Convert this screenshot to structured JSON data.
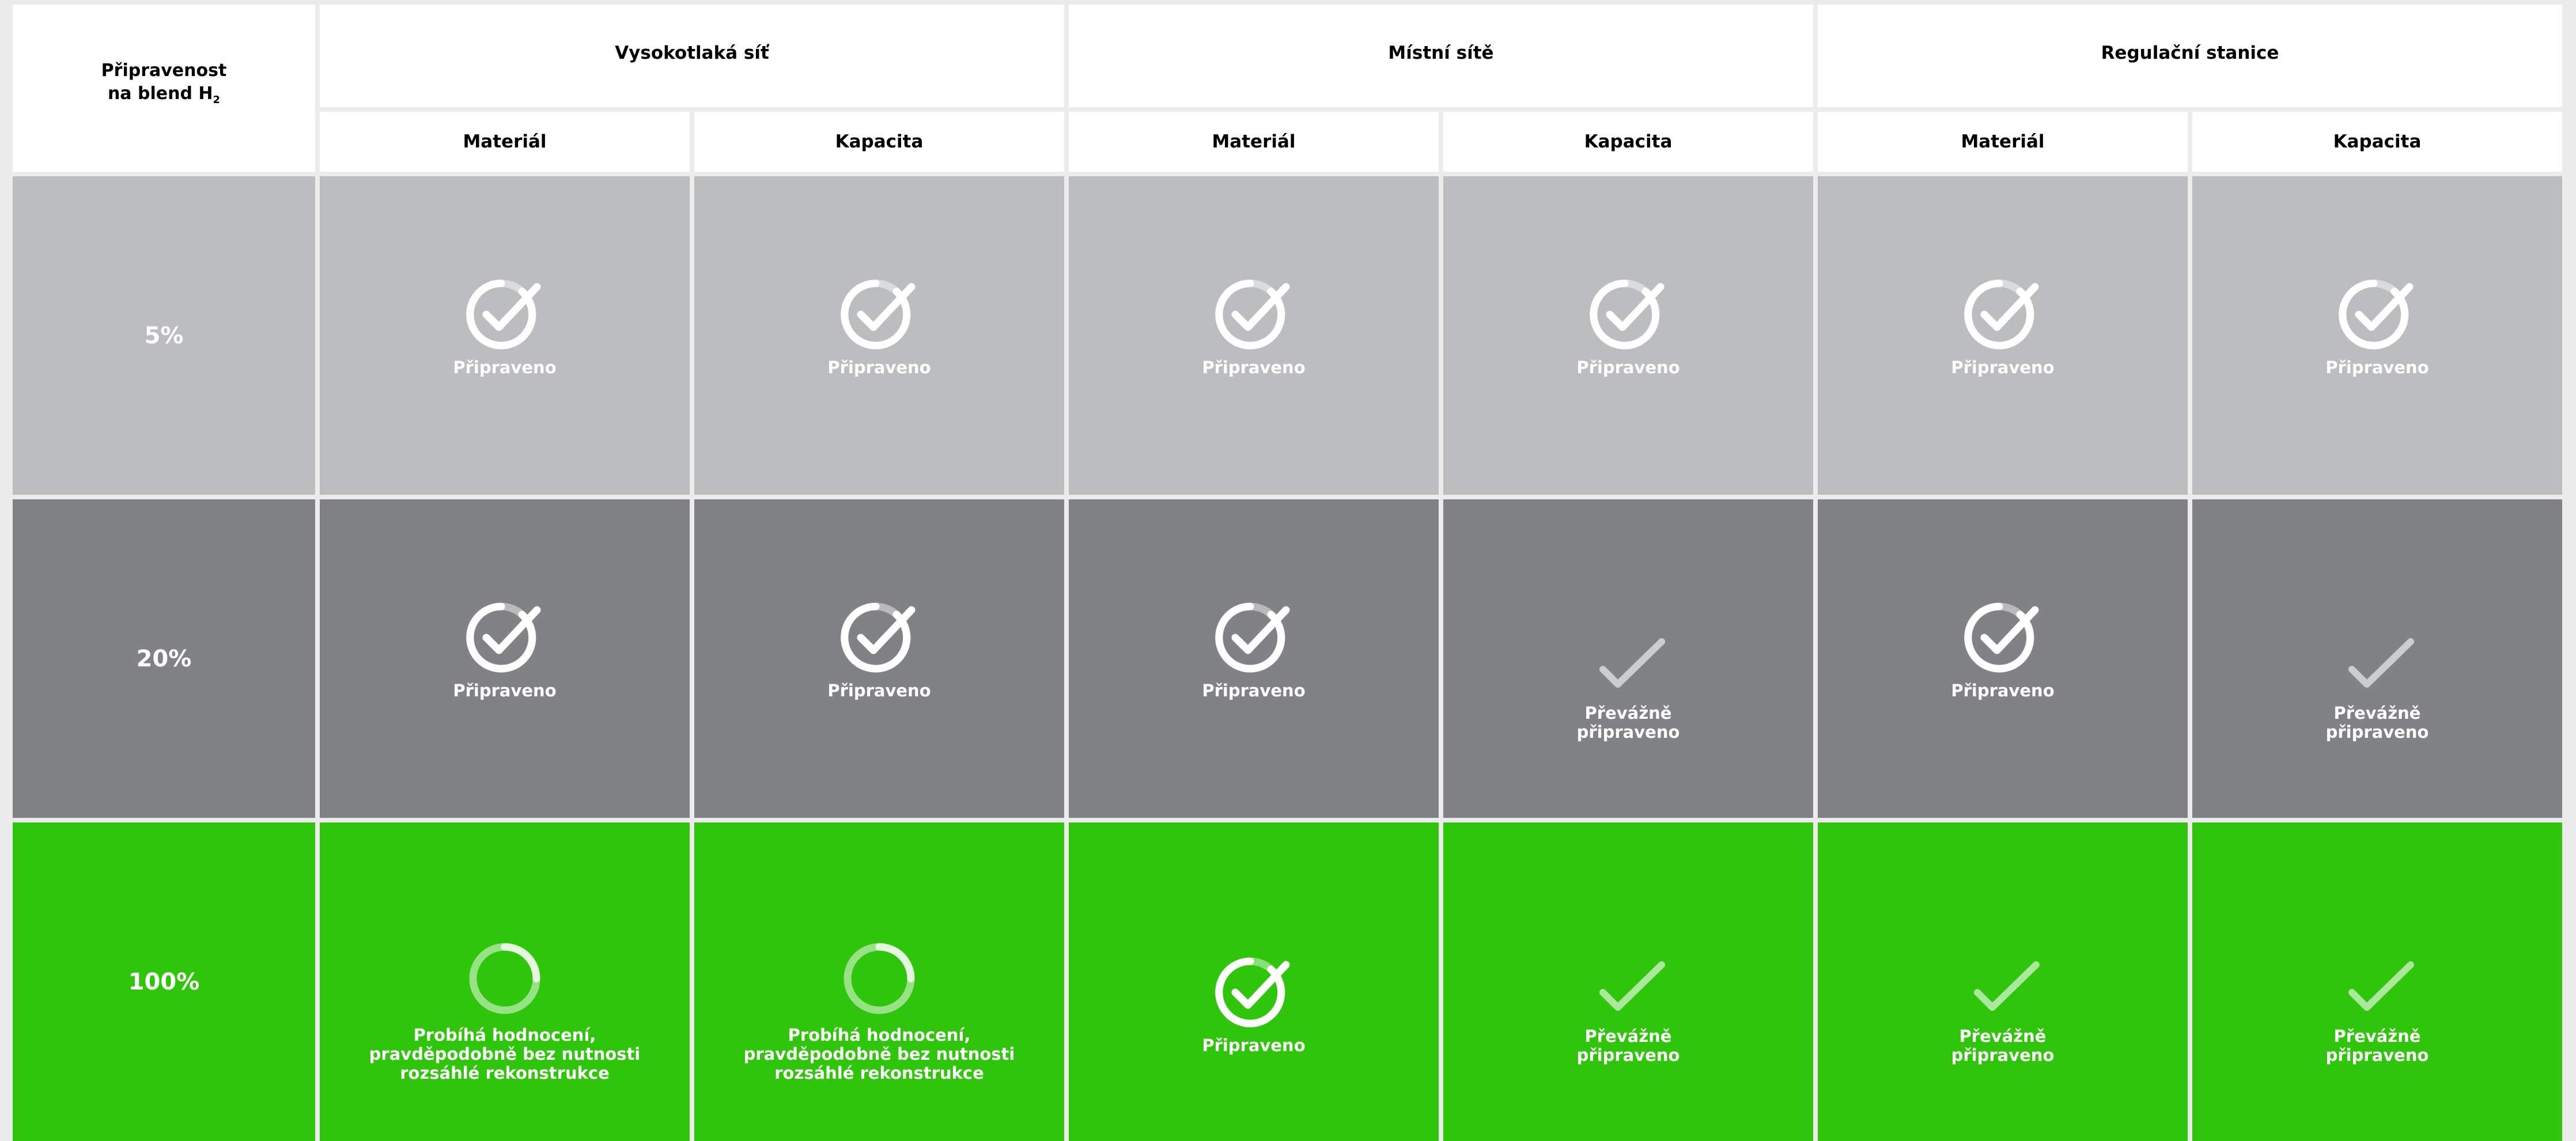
{
  "colors": {
    "row_5": "#bcbdbf",
    "row_20": "#818285",
    "row_100": "#2ec50a",
    "header_bg": "#ffffff",
    "page_bg": "#ececec"
  },
  "corner_header": {
    "line1": "Připravenost",
    "line2": "na blend H",
    "subscript": "2"
  },
  "groups": [
    "Vysokotlaká síť",
    "Místní sítě",
    "Regulační stanice"
  ],
  "subheaders": [
    "Materiál",
    "Kapacita",
    "Materiál",
    "Kapacita",
    "Materiál",
    "Kapacita"
  ],
  "rows": [
    {
      "label": "5%",
      "cells": [
        {
          "status": "ready",
          "icon": "circle-check-icon",
          "text": "Připraveno"
        },
        {
          "status": "ready",
          "icon": "circle-check-icon",
          "text": "Připraveno"
        },
        {
          "status": "ready",
          "icon": "circle-check-icon",
          "text": "Připraveno"
        },
        {
          "status": "ready",
          "icon": "circle-check-icon",
          "text": "Připraveno"
        },
        {
          "status": "ready",
          "icon": "circle-check-icon",
          "text": "Připraveno"
        },
        {
          "status": "ready",
          "icon": "circle-check-icon",
          "text": "Připraveno"
        }
      ]
    },
    {
      "label": "20%",
      "cells": [
        {
          "status": "ready",
          "icon": "circle-check-icon",
          "text": "Připraveno"
        },
        {
          "status": "ready",
          "icon": "circle-check-icon",
          "text": "Připraveno"
        },
        {
          "status": "ready",
          "icon": "circle-check-icon",
          "text": "Připraveno"
        },
        {
          "status": "mostly",
          "icon": "check-icon",
          "text": "Převážně\npřipraveno"
        },
        {
          "status": "ready",
          "icon": "circle-check-icon",
          "text": "Připraveno"
        },
        {
          "status": "mostly",
          "icon": "check-icon",
          "text": "Převážně\npřipraveno"
        }
      ]
    },
    {
      "label": "100%",
      "cells": [
        {
          "status": "eval",
          "icon": "progress-ring-icon",
          "text": "Probíhá hodnocení,\npravděpodobně bez nutnosti\nrozsáhlé rekonstrukce"
        },
        {
          "status": "eval",
          "icon": "progress-ring-icon",
          "text": "Probíhá hodnocení,\npravděpodobně bez nutnosti\nrozsáhlé rekonstrukce"
        },
        {
          "status": "ready",
          "icon": "circle-check-icon",
          "text": "Připraveno"
        },
        {
          "status": "mostly",
          "icon": "check-icon",
          "text": "Převážně\npřipraveno"
        },
        {
          "status": "mostly",
          "icon": "check-icon",
          "text": "Převážně\npřipraveno"
        },
        {
          "status": "mostly",
          "icon": "check-icon",
          "text": "Převážně\npřipraveno"
        }
      ]
    }
  ]
}
